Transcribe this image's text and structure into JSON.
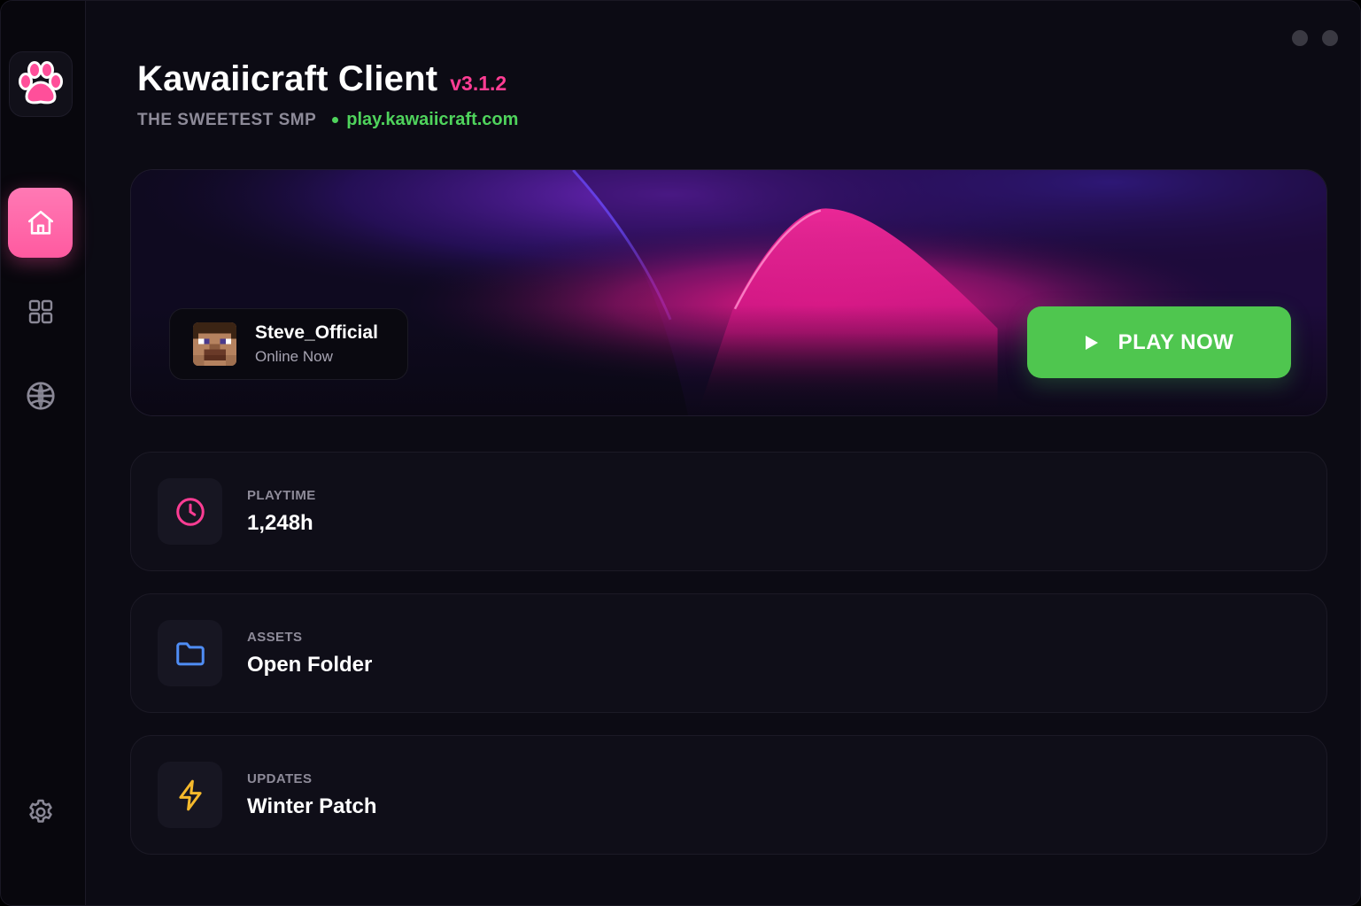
{
  "app": {
    "title": "Kawaiicraft Client",
    "version": "v3.1.2",
    "tagline": "THE SWEETEST SMP",
    "server": "play.kawaiicraft.com"
  },
  "sidebar": {
    "items": [
      {
        "name": "home",
        "icon": "home-icon",
        "active": true
      },
      {
        "name": "grid",
        "icon": "grid-icon",
        "active": false
      },
      {
        "name": "globe",
        "icon": "globe-icon",
        "active": false
      },
      {
        "name": "settings",
        "icon": "gear-icon",
        "active": false
      }
    ]
  },
  "profile": {
    "username": "Steve_Official",
    "status": "Online Now"
  },
  "hero": {
    "play_label": "PLAY NOW"
  },
  "cards": [
    {
      "label": "PLAYTIME",
      "value": "1,248h",
      "icon": "clock-icon",
      "accent": "#ff3d94"
    },
    {
      "label": "ASSETS",
      "value": "Open Folder",
      "icon": "folder-icon",
      "accent": "#4f8df5"
    },
    {
      "label": "UPDATES",
      "value": "Winter Patch",
      "icon": "bolt-icon",
      "accent": "#f5b92c"
    }
  ],
  "colors": {
    "accent_pink": "#ff5aa0",
    "accent_green": "#4fc64f",
    "background": "#0c0b14"
  }
}
